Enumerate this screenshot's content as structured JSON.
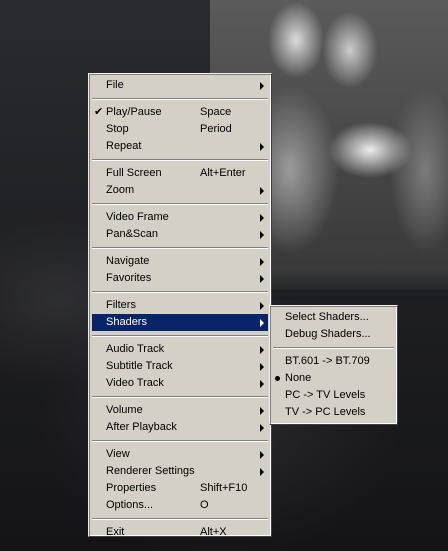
{
  "main_menu": {
    "groups": [
      [
        {
          "label": "File",
          "arrow": true
        }
      ],
      [
        {
          "label": "Play/Pause",
          "accel": "Space",
          "checked": true
        },
        {
          "label": "Stop",
          "accel": "Period"
        },
        {
          "label": "Repeat",
          "arrow": true
        }
      ],
      [
        {
          "label": "Full Screen",
          "accel": "Alt+Enter"
        },
        {
          "label": "Zoom",
          "arrow": true
        }
      ],
      [
        {
          "label": "Video Frame",
          "arrow": true
        },
        {
          "label": "Pan&Scan",
          "arrow": true
        }
      ],
      [
        {
          "label": "Navigate",
          "arrow": true
        },
        {
          "label": "Favorites",
          "arrow": true
        }
      ],
      [
        {
          "label": "Filters",
          "arrow": true
        },
        {
          "label": "Shaders",
          "arrow": true,
          "highlighted": true
        }
      ],
      [
        {
          "label": "Audio Track",
          "arrow": true
        },
        {
          "label": "Subtitle Track",
          "arrow": true
        },
        {
          "label": "Video Track",
          "arrow": true
        }
      ],
      [
        {
          "label": "Volume",
          "arrow": true
        },
        {
          "label": "After Playback",
          "arrow": true
        }
      ],
      [
        {
          "label": "View",
          "arrow": true
        },
        {
          "label": "Renderer Settings",
          "arrow": true
        },
        {
          "label": "Properties",
          "accel": "Shift+F10"
        },
        {
          "label": "Options...",
          "accel": "O"
        }
      ],
      [
        {
          "label": "Exit",
          "accel": "Alt+X"
        }
      ]
    ]
  },
  "shaders_submenu": {
    "groups": [
      [
        {
          "label": "Select Shaders..."
        },
        {
          "label": "Debug Shaders..."
        }
      ],
      [
        {
          "label": "BT.601 -> BT.709"
        },
        {
          "label": "None",
          "radio": true
        },
        {
          "label": "PC -> TV Levels"
        },
        {
          "label": "TV -> PC Levels"
        }
      ]
    ]
  },
  "colors": {
    "menu_bg": "#d4d0c8",
    "highlight": "#0a246a",
    "highlight_text": "#ffffff"
  }
}
